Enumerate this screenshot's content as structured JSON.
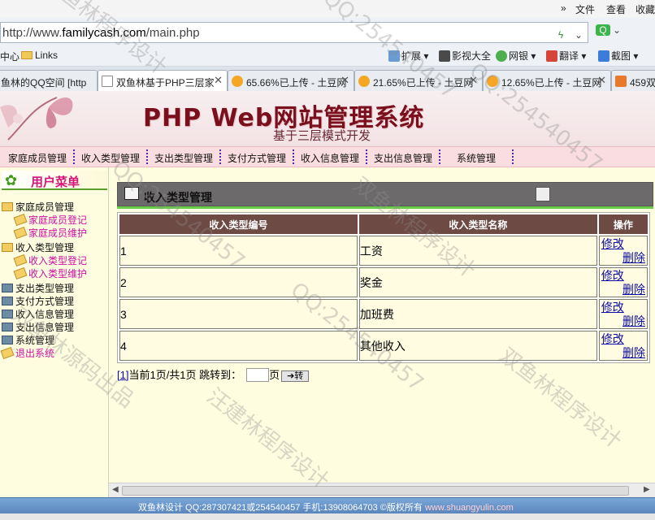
{
  "browser": {
    "menu": [
      "文件",
      "查看",
      "收藏"
    ],
    "menu_chevron": "»",
    "url_prefix": "http://www.",
    "url_domain": "familycash.com",
    "url_path": "/main.php",
    "fav_center": "中心",
    "fav_links": "Links",
    "toolbar": [
      {
        "label": "扩展 ▾",
        "icon": "puzzle-icon",
        "color": "#6a9bd1"
      },
      {
        "label": "影视大全",
        "icon": "film-icon",
        "color": "#4a4a4a"
      },
      {
        "label": "网银 ▾",
        "icon": "bank-icon",
        "color": "#4caf50"
      },
      {
        "label": "翻译 ▾",
        "icon": "translate-icon",
        "color": "#d6453a"
      },
      {
        "label": "截图 ▾",
        "icon": "screenshot-icon",
        "color": "#3b7dd8"
      }
    ],
    "tabs": [
      {
        "label": "鱼林的QQ空间 [http",
        "active": false
      },
      {
        "label": "双鱼林基于PHP三层家",
        "active": true
      },
      {
        "label": "65.66%已上传 - 土豆网",
        "active": false
      },
      {
        "label": "21.65%已上传 - 土豆网",
        "active": false
      },
      {
        "label": "12.65%已上传 - 土豆网",
        "active": false
      },
      {
        "label": "459双",
        "active": false
      }
    ],
    "tab_close": "✕"
  },
  "banner": {
    "title": "PHP Web网站管理系统",
    "subtitle": "基于三层模式开发"
  },
  "nav": [
    "家庭成员管理",
    "收入类型管理",
    "支出类型管理",
    "支付方式管理",
    "收入信息管理",
    "支出信息管理",
    "系统管理"
  ],
  "sidebar": {
    "header": "用户菜单",
    "items": [
      {
        "label": "家庭成员管理",
        "type": "folder",
        "level": 0
      },
      {
        "label": "家庭成员登记",
        "type": "leaf",
        "level": 1
      },
      {
        "label": "家庭成员维护",
        "type": "leaf",
        "level": 1
      },
      {
        "label": "收入类型管理",
        "type": "folder",
        "level": 0
      },
      {
        "label": "收入类型登记",
        "type": "leaf",
        "level": 1
      },
      {
        "label": "收入类型维护",
        "type": "leaf",
        "level": 1
      },
      {
        "label": "支出类型管理",
        "type": "book",
        "level": 0
      },
      {
        "label": "支付方式管理",
        "type": "book",
        "level": 0
      },
      {
        "label": "收入信息管理",
        "type": "book",
        "level": 0
      },
      {
        "label": "支出信息管理",
        "type": "book",
        "level": 0
      },
      {
        "label": "系统管理",
        "type": "book",
        "level": 0
      },
      {
        "label": "退出系统",
        "type": "exit",
        "level": 0
      }
    ]
  },
  "content": {
    "title": "收入类型管理",
    "columns": [
      "收入类型编号",
      "收入类型名称",
      "操作"
    ],
    "rows": [
      {
        "id": "1",
        "name": "工资"
      },
      {
        "id": "2",
        "name": "奖金"
      },
      {
        "id": "3",
        "name": "加班费"
      },
      {
        "id": "4",
        "name": "其他收入"
      }
    ],
    "edit_label": "修改",
    "delete_label": "删除",
    "pager": {
      "page_link": "[1]",
      "summary": "当前1页/共1页 跳转到：",
      "page_unit": "页",
      "go_label": "➔转"
    }
  },
  "footer": {
    "text": "双鱼林设计 QQ:287307421或254540457 手机:13908064703 ©版权所有 ",
    "site": "www.shuangyulin.com"
  },
  "watermarks": [
    "双鱼林程序设计",
    "QQ:254540457",
    "汪建林程序设计",
    "双鱼林源码出品"
  ]
}
